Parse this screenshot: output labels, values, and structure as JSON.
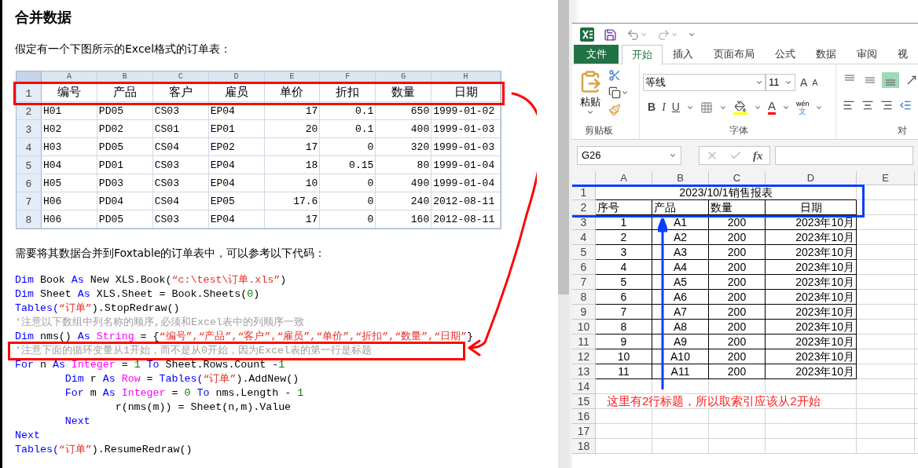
{
  "article": {
    "title": "合并数据",
    "intro": "假定有一个下图所示的Excel格式的订单表：",
    "sheet": {
      "columns": [
        "A",
        "B",
        "C",
        "D",
        "E",
        "F",
        "G",
        "H"
      ],
      "rows": [
        {
          "number": "1",
          "kind": "header",
          "cells": [
            "编号",
            "产品",
            "客户",
            "雇员",
            "单价",
            "折扣",
            "数量",
            "日期"
          ]
        },
        {
          "number": "2",
          "kind": "data",
          "cells": [
            "H01",
            "PD05",
            "CS03",
            "EP04",
            "17",
            "0.1",
            "650",
            "1999-01-02"
          ]
        },
        {
          "number": "3",
          "kind": "data",
          "cells": [
            "H02",
            "PD02",
            "CS01",
            "EP01",
            "20",
            "0.1",
            "400",
            "1999-01-03"
          ]
        },
        {
          "number": "4",
          "kind": "data",
          "cells": [
            "H03",
            "PD05",
            "CS04",
            "EP02",
            "17",
            "0",
            "320",
            "1999-01-03"
          ]
        },
        {
          "number": "5",
          "kind": "data",
          "cells": [
            "H04",
            "PD01",
            "CS03",
            "EP04",
            "18",
            "0.15",
            "80",
            "1999-01-04"
          ]
        },
        {
          "number": "6",
          "kind": "data",
          "cells": [
            "H05",
            "PD03",
            "CS03",
            "EP04",
            "10",
            "0",
            "490",
            "1999-01-04"
          ]
        },
        {
          "number": "7",
          "kind": "data",
          "cells": [
            "H06",
            "PD04",
            "CS04",
            "EP05",
            "17.6",
            "0",
            "240",
            "2012-08-11"
          ]
        },
        {
          "number": "8",
          "kind": "data",
          "cells": [
            "H06",
            "PD05",
            "CS03",
            "EP04",
            "17",
            "0",
            "160",
            "2012-08-11"
          ]
        }
      ]
    },
    "lead": "需要将其数据合并到Foxtable的订单表中，可以参考以下代码：",
    "code": [
      {
        "tokens": [
          {
            "kind": "keyword",
            "text": "Dim"
          },
          {
            "kind": "plain",
            "text": " Book "
          },
          {
            "kind": "keyword",
            "text": "As"
          },
          {
            "kind": "plain",
            "text": " New XLS.Book("
          },
          {
            "kind": "string",
            "text": "“c:\\test\\订单.xls”"
          },
          {
            "kind": "plain",
            "text": ")"
          }
        ]
      },
      {
        "tokens": [
          {
            "kind": "keyword",
            "text": "Dim"
          },
          {
            "kind": "plain",
            "text": " Sheet "
          },
          {
            "kind": "keyword",
            "text": "As"
          },
          {
            "kind": "plain",
            "text": " XLS.Sheet = Book.Sheets("
          },
          {
            "kind": "number",
            "text": "0"
          },
          {
            "kind": "plain",
            "text": ")"
          }
        ]
      },
      {
        "tokens": [
          {
            "kind": "keyword",
            "text": "Tables("
          },
          {
            "kind": "string",
            "text": "“订单”"
          },
          {
            "kind": "plain",
            "text": ").StopRedraw()"
          }
        ]
      },
      {
        "tokens": [
          {
            "kind": "comment",
            "text": "'注意以下数组中列名称的顺序,必须和Excel表中的列顺序一致"
          }
        ]
      },
      {
        "tokens": [
          {
            "kind": "keyword",
            "text": "Dim"
          },
          {
            "kind": "plain",
            "text": " nms() "
          },
          {
            "kind": "keyword",
            "text": "As"
          },
          {
            "kind": "type",
            "text": " String"
          },
          {
            "kind": "plain",
            "text": " = {"
          },
          {
            "kind": "string",
            "text": "“编号”,“产品”,“客户”,“雇员”,“单价”,“折扣”,“数量”,“日期”"
          },
          {
            "kind": "plain",
            "text": "}"
          }
        ]
      },
      {
        "tokens": [
          {
            "kind": "comment",
            "text": "'注意下面的循环变量从1开始，而不是从0开始，因为Excel表的第一行是标题"
          }
        ]
      },
      {
        "tokens": [
          {
            "kind": "keyword",
            "text": "For"
          },
          {
            "kind": "plain",
            "text": " n "
          },
          {
            "kind": "keyword",
            "text": "As"
          },
          {
            "kind": "type",
            "text": " Integer"
          },
          {
            "kind": "plain",
            "text": " = "
          },
          {
            "kind": "number",
            "text": "1"
          },
          {
            "kind": "keyword",
            "text": " To"
          },
          {
            "kind": "plain",
            "text": " Sheet.Rows.Count -"
          },
          {
            "kind": "number",
            "text": "1"
          }
        ]
      },
      {
        "tokens": [
          {
            "kind": "keyword",
            "text": "        Dim"
          },
          {
            "kind": "plain",
            "text": " r "
          },
          {
            "kind": "keyword",
            "text": "As"
          },
          {
            "kind": "type",
            "text": " Row"
          },
          {
            "kind": "plain",
            "text": " = "
          },
          {
            "kind": "keyword",
            "text": "Tables("
          },
          {
            "kind": "string",
            "text": "“订单”"
          },
          {
            "kind": "plain",
            "text": ").AddNew()"
          }
        ]
      },
      {
        "tokens": [
          {
            "kind": "keyword",
            "text": "        For"
          },
          {
            "kind": "plain",
            "text": " m "
          },
          {
            "kind": "keyword",
            "text": "As"
          },
          {
            "kind": "type",
            "text": " Integer"
          },
          {
            "kind": "plain",
            "text": " = "
          },
          {
            "kind": "number",
            "text": "0"
          },
          {
            "kind": "keyword",
            "text": " To"
          },
          {
            "kind": "plain",
            "text": " nms.Length - "
          },
          {
            "kind": "number",
            "text": "1"
          }
        ]
      },
      {
        "tokens": [
          {
            "kind": "plain",
            "text": "                r(nms(m)) = Sheet(n,m).Value"
          }
        ]
      },
      {
        "tokens": [
          {
            "kind": "keyword",
            "text": "        Next"
          }
        ]
      },
      {
        "tokens": [
          {
            "kind": "keyword",
            "text": "Next"
          }
        ]
      },
      {
        "tokens": [
          {
            "kind": "keyword",
            "text": "Tables("
          },
          {
            "kind": "string",
            "text": "“订单”"
          },
          {
            "kind": "plain",
            "text": ").ResumeRedraw()"
          }
        ]
      }
    ]
  },
  "excel": {
    "tabs": [
      {
        "label": "文件",
        "kind": "file",
        "selected": false
      },
      {
        "label": "开始",
        "kind": "tab",
        "selected": true
      },
      {
        "label": "插入",
        "kind": "tab",
        "selected": false
      },
      {
        "label": "页面布局",
        "kind": "tab",
        "selected": false
      },
      {
        "label": "公式",
        "kind": "tab",
        "selected": false
      },
      {
        "label": "数据",
        "kind": "tab",
        "selected": false
      },
      {
        "label": "审阅",
        "kind": "tab",
        "selected": false
      },
      {
        "label": "视",
        "kind": "tab",
        "selected": false
      }
    ],
    "clipboard": {
      "paste": "粘贴",
      "label": "剪贴板"
    },
    "font": {
      "name": "等线",
      "size": "11",
      "grow": "A",
      "shrink": "A",
      "bold": "B",
      "italic": "I",
      "underline": "U",
      "color_letter": "A",
      "phonetic_top": "wén",
      "phonetic_bottom": "文",
      "label": "字体"
    },
    "alignment": {
      "label": "对",
      "vertical": [
        {
          "selected": false
        },
        {
          "selected": false
        },
        {
          "selected": true
        }
      ]
    },
    "formula_bar": {
      "name_box": "G26",
      "function_label": "fx"
    },
    "sheet": {
      "columns": [
        "A",
        "B",
        "C",
        "D",
        "E"
      ],
      "rows": [
        {
          "number": "1",
          "kind": "title",
          "cells": [
            "2023/10/1销售报表"
          ]
        },
        {
          "number": "2",
          "kind": "header",
          "cells": [
            "序号",
            "产品",
            "数量",
            "日期"
          ]
        },
        {
          "number": "3",
          "kind": "data",
          "cells": [
            "1",
            "A1",
            "200",
            "2023年10月"
          ]
        },
        {
          "number": "4",
          "kind": "data",
          "cells": [
            "2",
            "A2",
            "200",
            "2023年10月"
          ]
        },
        {
          "number": "5",
          "kind": "data",
          "cells": [
            "3",
            "A3",
            "200",
            "2023年10月"
          ]
        },
        {
          "number": "6",
          "kind": "data",
          "cells": [
            "4",
            "A4",
            "200",
            "2023年10月"
          ]
        },
        {
          "number": "7",
          "kind": "data",
          "cells": [
            "5",
            "A5",
            "200",
            "2023年10月"
          ]
        },
        {
          "number": "8",
          "kind": "data",
          "cells": [
            "6",
            "A6",
            "200",
            "2023年10月"
          ]
        },
        {
          "number": "9",
          "kind": "data",
          "cells": [
            "7",
            "A7",
            "200",
            "2023年10月"
          ]
        },
        {
          "number": "10",
          "kind": "data",
          "cells": [
            "8",
            "A8",
            "200",
            "2023年10月"
          ]
        },
        {
          "number": "11",
          "kind": "data",
          "cells": [
            "9",
            "A9",
            "200",
            "2023年10月"
          ]
        },
        {
          "number": "12",
          "kind": "data",
          "cells": [
            "10",
            "A10",
            "200",
            "2023年10月"
          ]
        },
        {
          "number": "13",
          "kind": "data",
          "cells": [
            "11",
            "A11",
            "200",
            "2023年10月"
          ]
        },
        {
          "number": "14",
          "kind": "empty"
        },
        {
          "number": "15",
          "kind": "note",
          "cells": [
            "这里有2行标题，所以取索引应该从2开始"
          ]
        },
        {
          "number": "16",
          "kind": "empty"
        },
        {
          "number": "17",
          "kind": "empty"
        },
        {
          "number": "18",
          "kind": "empty"
        }
      ]
    }
  }
}
